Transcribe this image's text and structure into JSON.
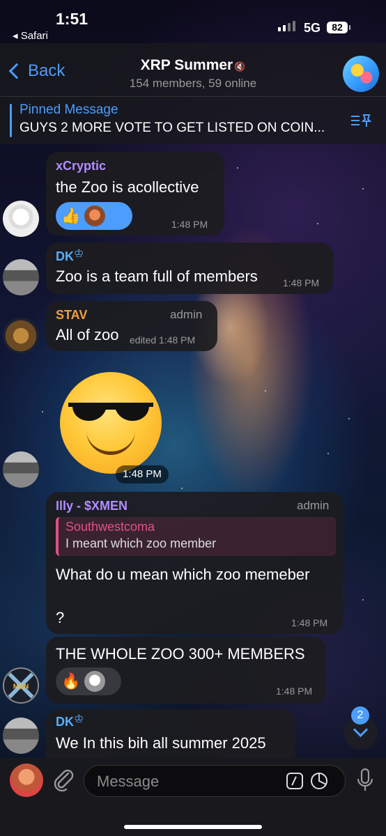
{
  "status": {
    "time": "1:51",
    "back_app": "◂ Safari",
    "network": "5G",
    "battery": "82"
  },
  "header": {
    "back_label": "Back",
    "title": "XRP Summer",
    "subtitle": "154 members, 59 online"
  },
  "pinned": {
    "label": "Pinned Message",
    "text": "GUYS 2 MORE VOTE TO GET LISTED ON COIN..."
  },
  "messages": [
    {
      "sender": "xCryptic",
      "sender_color": "#b38cff",
      "text": "the Zoo is acollective",
      "time": "1:48 PM",
      "reactions": [
        "👍",
        "avatar"
      ]
    },
    {
      "sender": "DK",
      "sender_color": "#5ab0ff",
      "text": "Zoo is a team full of members",
      "time": "1:48 PM"
    },
    {
      "sender": "STAV",
      "sender_color": "#f0a040",
      "role": "admin",
      "text": "All of zoo",
      "time": "edited 1:48 PM"
    },
    {
      "sender": "DK",
      "sticker": "😎",
      "time": "1:48 PM"
    },
    {
      "sender": "Illy - $XMEN",
      "sender_color": "#b38cff",
      "role": "admin",
      "reply_to": {
        "name": "Southwestcoma",
        "text": "I meant which zoo member"
      },
      "text": "What do u mean which zoo memeber",
      "text2": "?",
      "time": "1:48 PM"
    },
    {
      "text": "THE WHOLE ZOO 300+ MEMBERS",
      "time": "1:48 PM",
      "reactions": [
        "🔥",
        "avatar"
      ]
    },
    {
      "sender": "DK",
      "sender_color": "#5ab0ff",
      "text": "We In this bih all summer 2025"
    }
  ],
  "scroll_badge": "2",
  "input": {
    "placeholder": "Message"
  },
  "colors": {
    "accent": "#4c9dfc",
    "bubble": "#1c1c20"
  }
}
